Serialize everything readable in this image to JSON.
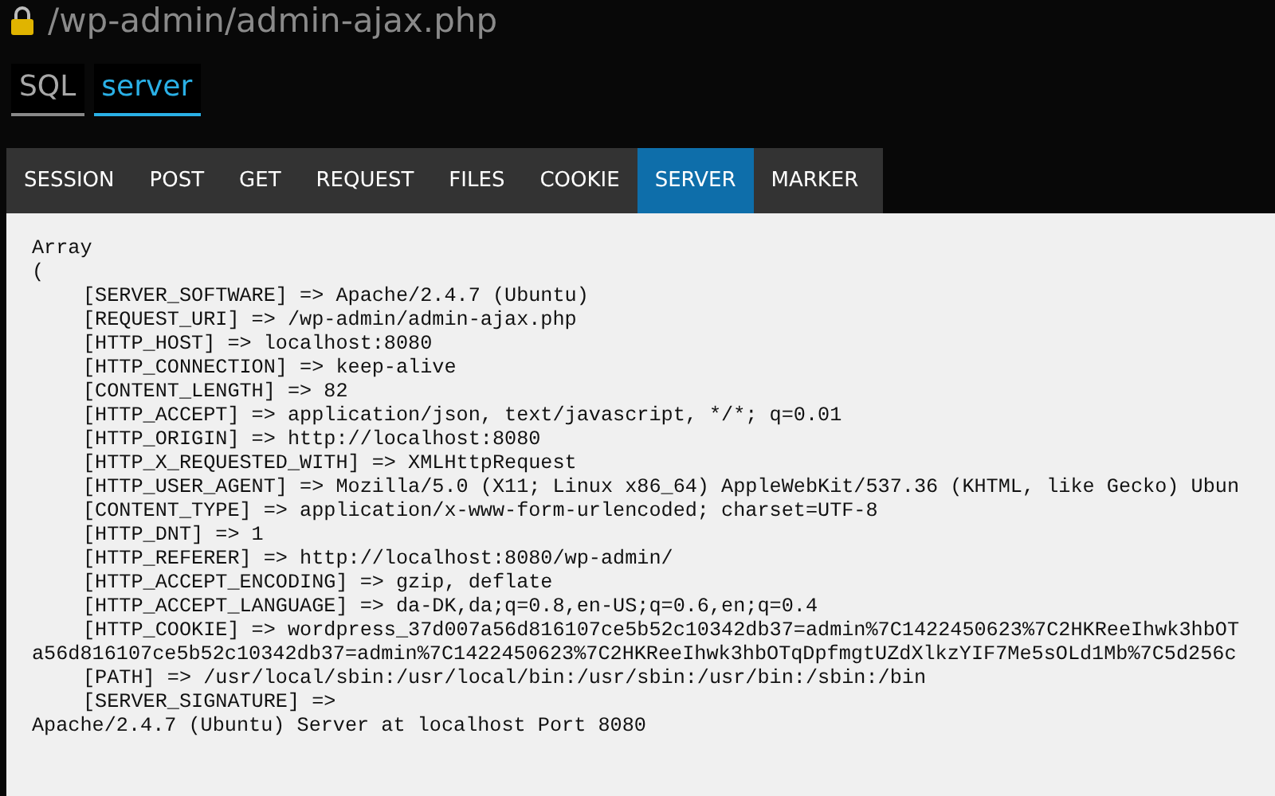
{
  "title": "/wp-admin/admin-ajax.php",
  "view_tabs": [
    {
      "label": "SQL",
      "selected": false
    },
    {
      "label": "server",
      "selected": true
    }
  ],
  "tabs": [
    {
      "label": "SESSION",
      "selected": false
    },
    {
      "label": "POST",
      "selected": false
    },
    {
      "label": "GET",
      "selected": false
    },
    {
      "label": "REQUEST",
      "selected": false
    },
    {
      "label": "FILES",
      "selected": false
    },
    {
      "label": "COOKIE",
      "selected": false
    },
    {
      "label": "SERVER",
      "selected": true
    },
    {
      "label": "MARKER",
      "selected": false
    }
  ],
  "output": [
    {
      "kind": "plain",
      "text": "Array"
    },
    {
      "kind": "plain",
      "text": "("
    },
    {
      "kind": "entry",
      "text": "[SERVER_SOFTWARE] => Apache/2.4.7 (Ubuntu)"
    },
    {
      "kind": "entry",
      "text": "[REQUEST_URI] => /wp-admin/admin-ajax.php"
    },
    {
      "kind": "entry",
      "text": "[HTTP_HOST] => localhost:8080"
    },
    {
      "kind": "entry",
      "text": "[HTTP_CONNECTION] => keep-alive"
    },
    {
      "kind": "entry",
      "text": "[CONTENT_LENGTH] => 82"
    },
    {
      "kind": "entry",
      "text": "[HTTP_ACCEPT] => application/json, text/javascript, */*; q=0.01"
    },
    {
      "kind": "entry",
      "text": "[HTTP_ORIGIN] => http://localhost:8080"
    },
    {
      "kind": "entry",
      "text": "[HTTP_X_REQUESTED_WITH] => XMLHttpRequest"
    },
    {
      "kind": "entry",
      "text": "[HTTP_USER_AGENT] => Mozilla/5.0 (X11; Linux x86_64) AppleWebKit/537.36 (KHTML, like Gecko) Ubun"
    },
    {
      "kind": "entry",
      "text": "[CONTENT_TYPE] => application/x-www-form-urlencoded; charset=UTF-8"
    },
    {
      "kind": "entry",
      "text": "[HTTP_DNT] => 1"
    },
    {
      "kind": "entry",
      "text": "[HTTP_REFERER] => http://localhost:8080/wp-admin/"
    },
    {
      "kind": "entry",
      "text": "[HTTP_ACCEPT_ENCODING] => gzip, deflate"
    },
    {
      "kind": "entry",
      "text": "[HTTP_ACCEPT_LANGUAGE] => da-DK,da;q=0.8,en-US;q=0.6,en;q=0.4"
    },
    {
      "kind": "entry",
      "text": "[HTTP_COOKIE] => wordpress_37d007a56d816107ce5b52c10342db37=admin%7C1422450623%7C2HKReeIhwk3hbOT"
    },
    {
      "kind": "plain",
      "text": "a56d816107ce5b52c10342db37=admin%7C1422450623%7C2HKReeIhwk3hbOTqDpfmgtUZdXlkzYIF7Me5sOLd1Mb%7C5d256c"
    },
    {
      "kind": "entry",
      "text": "[PATH] => /usr/local/sbin:/usr/local/bin:/usr/sbin:/usr/bin:/sbin:/bin"
    },
    {
      "kind": "entry",
      "text": "[SERVER_SIGNATURE] =>"
    },
    {
      "kind": "plain",
      "text": "Apache/2.4.7 (Ubuntu) Server at localhost Port 8080"
    }
  ]
}
